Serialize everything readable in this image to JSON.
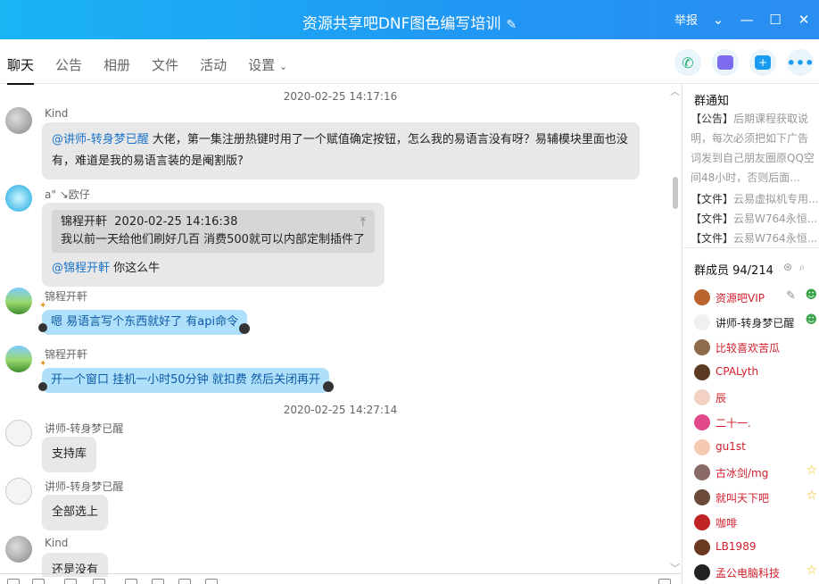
{
  "titlebar": {
    "title": "资源共享吧DNF图色编写培训",
    "edit_icon": "pencil-icon",
    "report": "举报"
  },
  "nav": {
    "tabs": [
      "聊天",
      "公告",
      "相册",
      "文件",
      "活动",
      "设置"
    ],
    "active_tab": "聊天",
    "actions": [
      "phone-call-icon",
      "video-call-icon",
      "add-app-icon",
      "more-icon"
    ]
  },
  "chat": {
    "messages": [
      {
        "time": "2020-02-25 14:17:16"
      },
      {
        "sender": "Kind",
        "mention": "@讲师-转身梦已醒",
        "text": " 大佬，第一集注册热键时用了一个赋值确定按钮，怎么我的易语言没有呀？易辅模块里面也没有，难道是我的易语言装的是阉割版?"
      },
      {
        "sender": "a\" ↘欧仔",
        "quote_author": "锦程开軒",
        "quote_time": "2020-02-25 14:16:38",
        "quote_text": "我以前一天给他们刷好几百 消费500就可以内部定制插件了",
        "mention": "@锦程开軒",
        "text": " 你这么牛"
      },
      {
        "sender": "锦程开軒",
        "text": "嗯 易语言写个东西就好了 有api命令"
      },
      {
        "sender": "锦程开軒",
        "text": "开一个窗口 挂机一小时50分钟 就扣费 然后关闭再开"
      },
      {
        "time": "2020-02-25 14:27:14"
      },
      {
        "sender": "讲师-转身梦已醒",
        "text": "支持库"
      },
      {
        "sender": "讲师-转身梦已醒",
        "text": "全部选上"
      },
      {
        "sender": "Kind",
        "text": "还是没有"
      }
    ]
  },
  "side": {
    "notice_title": "群通知",
    "notice_label": "【公告】",
    "notice_text": "后期课程获取说明，每次必须把如下广告词发到自己朋友圈原QQ空间48小时，否则后面...",
    "files": [
      {
        "label": "【文件】",
        "name": "云易虚拟机专用..."
      },
      {
        "label": "【文件】",
        "name": "云易W764永恒..."
      },
      {
        "label": "【文件】",
        "name": "云易W764永恒..."
      }
    ],
    "members_title": "群成员 94/214",
    "members": [
      {
        "name": "资源吧VIP",
        "color": "#d0202c",
        "avatar": "#b9652d"
      },
      {
        "name": "讲师-转身梦已醒",
        "color": "#222222",
        "avatar": "#f0f0f0"
      },
      {
        "name": "比较喜欢苦瓜",
        "color": "#d0202c",
        "avatar": "#8e6b4a"
      },
      {
        "name": "CPALyth",
        "color": "#d0202c",
        "avatar": "#5a3a22"
      },
      {
        "name": "辰",
        "color": "#d0202c",
        "avatar": "#f2d1c4"
      },
      {
        "name": "二十一.",
        "color": "#d0202c",
        "avatar": "#e04a8a"
      },
      {
        "name": "gu1st",
        "color": "#d0202c",
        "avatar": "#f6c9b2"
      },
      {
        "name": "古冰剑/mg",
        "color": "#d0202c",
        "avatar": "#8a6a66"
      },
      {
        "name": "就叫天下吧",
        "color": "#d0202c",
        "avatar": "#6b4a3a"
      },
      {
        "name": "咖啡",
        "color": "#d0202c",
        "avatar": "#c02424"
      },
      {
        "name": "LB1989",
        "color": "#d0202c",
        "avatar": "#6a3a20"
      },
      {
        "name": "孟公电脑科技",
        "color": "#d0202c",
        "avatar": "#222222"
      }
    ]
  }
}
